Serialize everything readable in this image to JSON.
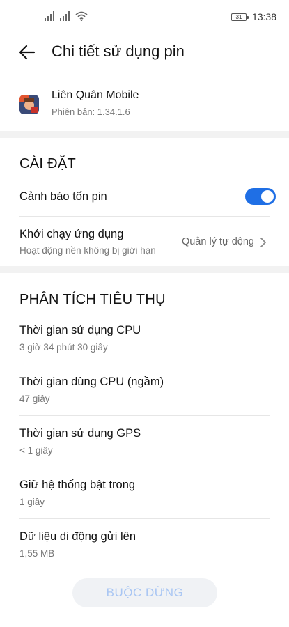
{
  "status_bar": {
    "time": "13:38",
    "battery_level": "31",
    "icons": [
      "signal-icon",
      "signal-icon",
      "wifi-icon",
      "battery-icon"
    ]
  },
  "header": {
    "title": "Chi tiết sử dụng pin"
  },
  "app": {
    "name": "Liên Quân Mobile",
    "version": "Phiên bản: 1.34.1.6"
  },
  "settings": {
    "section_title": "CÀI ĐẶT",
    "battery_warning": {
      "label": "Cảnh báo tốn pin",
      "enabled": true
    },
    "app_launch": {
      "label": "Khởi chạy ứng dụng",
      "sub": "Hoạt động nền không bị giới hạn",
      "action": "Quản lý tự động"
    }
  },
  "analysis": {
    "section_title": "PHÂN TÍCH TIÊU THỤ",
    "items": [
      {
        "label": "Thời gian sử dụng CPU",
        "value": "3 giờ 34 phút 30 giây"
      },
      {
        "label": "Thời gian dùng CPU (ngầm)",
        "value": "47 giây"
      },
      {
        "label": "Thời gian sử dụng GPS",
        "value": "< 1 giây"
      },
      {
        "label": "Giữ hệ thống bật trong",
        "value": "1 giây"
      },
      {
        "label": "Dữ liệu di động gửi lên",
        "value": "1,55 MB"
      }
    ]
  },
  "footer": {
    "stop_button": "BUỘC DỪNG"
  },
  "colors": {
    "accent": "#1f6fe5",
    "stop_text": "#a9c6f3",
    "divider": "#f2f2f2"
  }
}
